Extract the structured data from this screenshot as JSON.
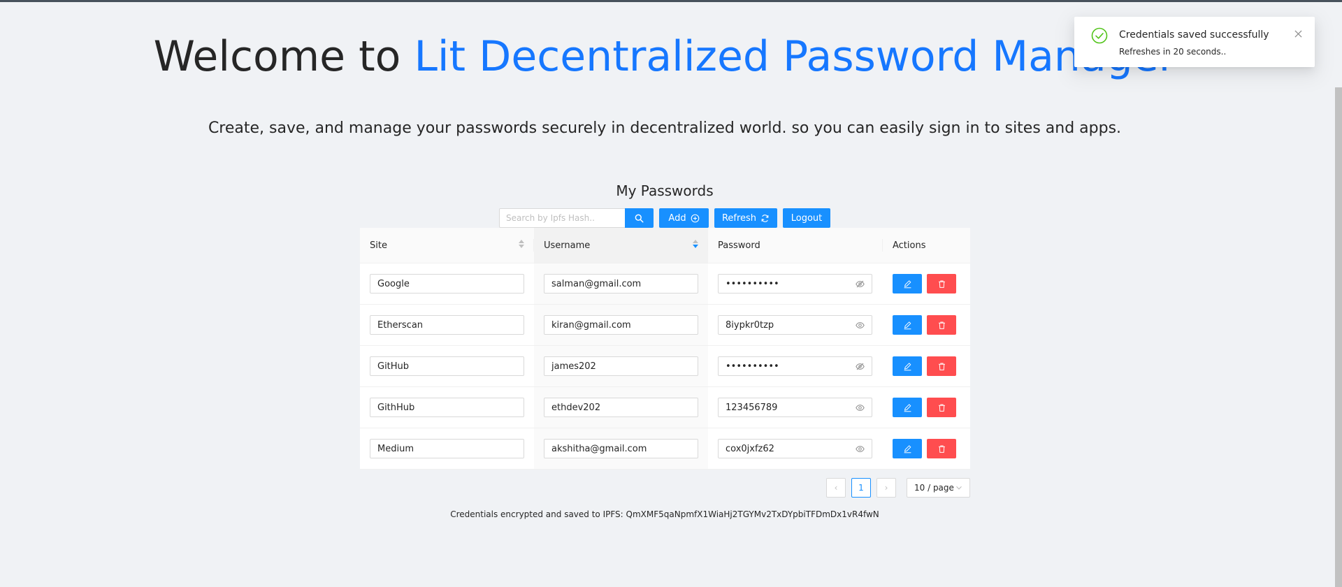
{
  "header": {
    "title_prefix": "Welcome to ",
    "title_accent": "Lit Decentralized Password Manager",
    "subtitle": "Create, save, and manage your passwords securely in decentralized world. so you can easily sign in to sites and apps."
  },
  "section": {
    "title": "My Passwords"
  },
  "toolbar": {
    "search_placeholder": "Search by Ipfs Hash..",
    "add_label": "Add",
    "refresh_label": "Refresh",
    "logout_label": "Logout"
  },
  "table": {
    "columns": [
      "Site",
      "Username",
      "Password",
      "Actions"
    ],
    "rows": [
      {
        "site": "Google",
        "username": "salman@gmail.com",
        "password": "••••••••••",
        "password_visible": false
      },
      {
        "site": "Etherscan",
        "username": "kiran@gmail.com",
        "password": "8iypkr0tzp",
        "password_visible": true
      },
      {
        "site": "GitHub",
        "username": "james202",
        "password": "••••••••••",
        "password_visible": false
      },
      {
        "site": "GithHub",
        "username": "ethdev202",
        "password": "123456789",
        "password_visible": true
      },
      {
        "site": "Medium",
        "username": "akshitha@gmail.com",
        "password": "cox0jxfz62",
        "password_visible": true
      }
    ]
  },
  "pagination": {
    "current_page": "1",
    "page_size_label": "10 / page",
    "prev_glyph": "‹",
    "next_glyph": "›"
  },
  "footer": {
    "note": "Credentials encrypted and saved to IPFS: QmXMF5qaNpmfX1WiaHj2TGYMv2TxDYpbiTFDmDx1vR4fwN"
  },
  "toast": {
    "title": "Credentials saved successfully",
    "description": "Refreshes in 20 seconds.."
  },
  "colors": {
    "primary": "#1890ff",
    "accent_title": "#1677ff",
    "danger": "#ff4d4f",
    "success": "#52c41a",
    "background": "#f0f2f5"
  },
  "icons": {
    "search": "search-icon",
    "add": "plus-circle-icon",
    "refresh": "sync-icon",
    "edit": "edit-icon",
    "delete": "trash-icon",
    "eye": "eye-icon",
    "eye_hidden": "eye-invisible-icon",
    "success": "check-circle-icon",
    "close": "close-icon"
  }
}
